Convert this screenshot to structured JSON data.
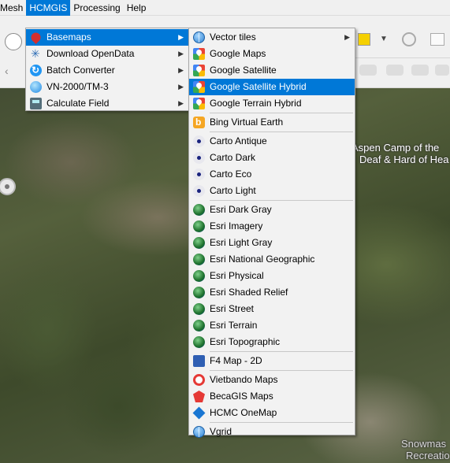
{
  "menubar": {
    "items": [
      "Mesh",
      "HCMGIS",
      "Processing",
      "Help"
    ]
  },
  "map": {
    "labels": [
      "Aspen Camp of the",
      "Deaf & Hard of Hea",
      "Snowmas",
      "Recreatio"
    ]
  },
  "hcmgis_menu": {
    "items": [
      {
        "label": "Basemaps",
        "icon": "map-pin-icon",
        "submenu": true,
        "highlighted": true
      },
      {
        "label": "Download OpenData",
        "icon": "download-icon",
        "submenu": true
      },
      {
        "label": "Batch Converter",
        "icon": "batch-icon",
        "submenu": true
      },
      {
        "label": "VN-2000/TM-3",
        "icon": "globe-icon",
        "submenu": true
      },
      {
        "label": "Calculate Field",
        "icon": "calculator-icon",
        "submenu": true
      }
    ]
  },
  "basemaps_menu": {
    "items": [
      {
        "label": "Vector tiles",
        "icon": "globe-icon",
        "submenu": true
      },
      {
        "label": "Google Maps",
        "icon": "google-maps-icon"
      },
      {
        "label": "Google Satellite",
        "icon": "google-maps-icon"
      },
      {
        "label": "Google Satellite Hybrid",
        "icon": "google-maps-icon",
        "highlighted": true
      },
      {
        "label": "Google Terrain Hybrid",
        "icon": "google-maps-icon"
      },
      {
        "label": "Bing Virtual Earth",
        "icon": "bing-icon"
      },
      {
        "label": "Carto Antique",
        "icon": "carto-icon"
      },
      {
        "label": "Carto Dark",
        "icon": "carto-icon"
      },
      {
        "label": "Carto Eco",
        "icon": "carto-icon"
      },
      {
        "label": "Carto Light",
        "icon": "carto-icon"
      },
      {
        "label": "Esri Dark Gray",
        "icon": "esri-icon"
      },
      {
        "label": "Esri Imagery",
        "icon": "esri-icon"
      },
      {
        "label": "Esri Light Gray",
        "icon": "esri-icon"
      },
      {
        "label": "Esri National Geographic",
        "icon": "esri-icon"
      },
      {
        "label": "Esri Physical",
        "icon": "esri-icon"
      },
      {
        "label": "Esri Shaded Relief",
        "icon": "esri-icon"
      },
      {
        "label": "Esri Street",
        "icon": "esri-icon"
      },
      {
        "label": "Esri Terrain",
        "icon": "esri-icon"
      },
      {
        "label": "Esri Topographic",
        "icon": "esri-icon"
      },
      {
        "label": "F4 Map - 2D",
        "icon": "f4map-icon"
      },
      {
        "label": "Vietbando Maps",
        "icon": "vietbando-icon"
      },
      {
        "label": "BecaGIS Maps",
        "icon": "becagis-icon"
      },
      {
        "label": "HCMC OneMap",
        "icon": "hcmc-onemap-icon"
      },
      {
        "label": "Vgrid",
        "icon": "globe-icon"
      }
    ]
  },
  "colors": {
    "highlight": "#0078d7",
    "menu_bg": "#f2f2f2"
  }
}
